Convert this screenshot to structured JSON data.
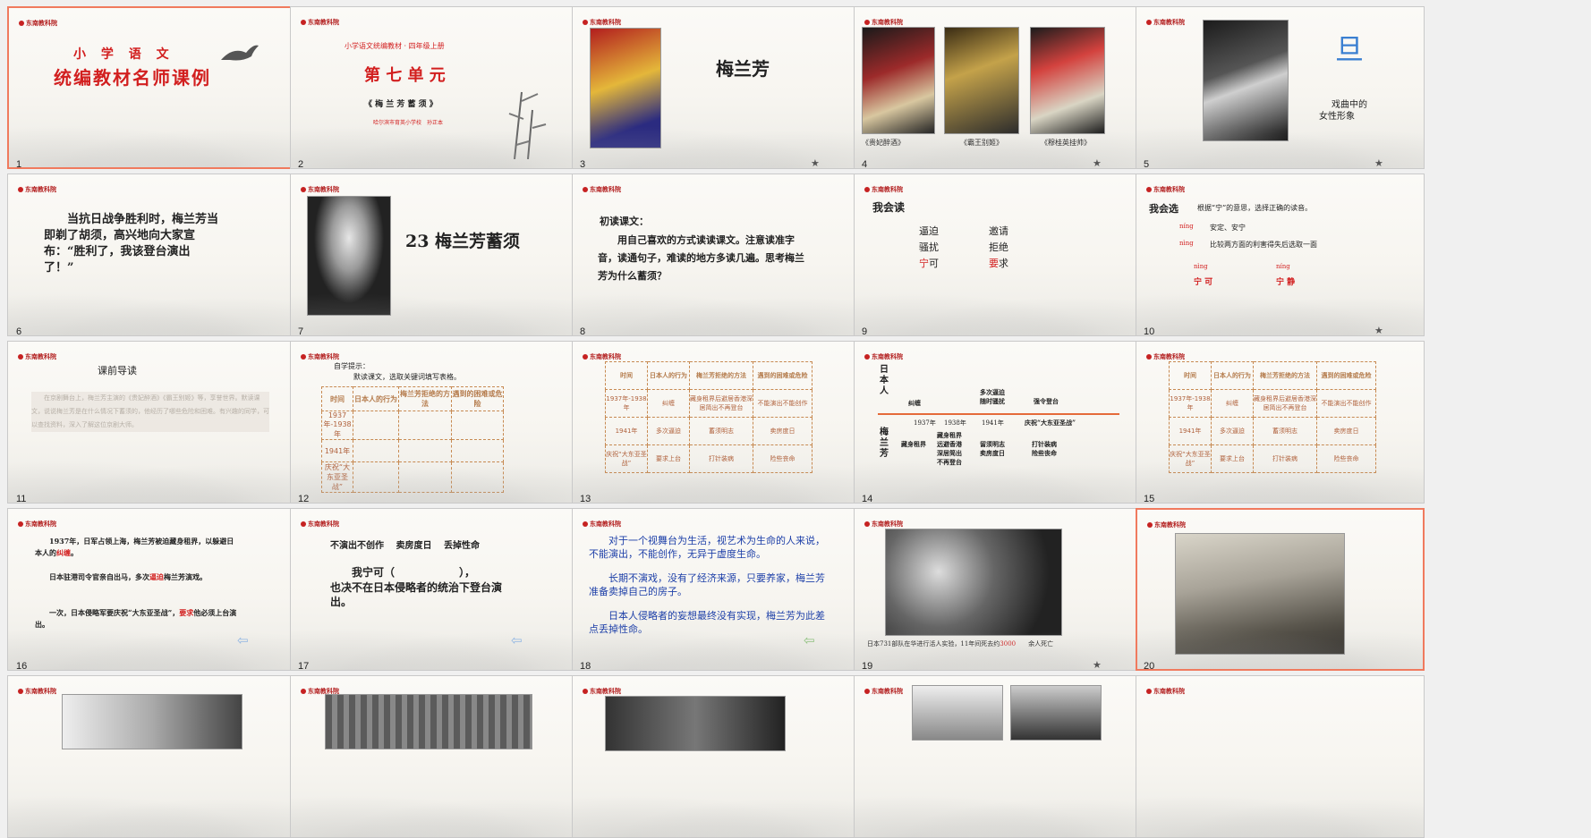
{
  "slides": {
    "s1": {
      "num": "1",
      "star": "",
      "logo": "东南教科院",
      "title1": "小 学 语 文",
      "title2": "统编教材名师课例"
    },
    "s2": {
      "num": "2",
      "star": "",
      "logo": "东南教科院",
      "line1": "小学语文统编教材 · 四年级上册",
      "unit": "第 七 单 元",
      "lesson": "《 梅 兰 芳 蓄 须 》",
      "author": "哈尔滨市育英小学校　孙正本"
    },
    "s3": {
      "num": "3",
      "star": "★",
      "logo": "东南教科院",
      "name": "梅兰芳"
    },
    "s4": {
      "num": "4",
      "star": "★",
      "logo": "东南教科院",
      "cap1": "《贵妃醉酒》",
      "cap2": "《霸王别姬》",
      "cap3": "《穆桂英挂帅》"
    },
    "s5": {
      "num": "5",
      "star": "★",
      "logo": "东南教科院",
      "char": "旦",
      "caption1": "戏曲中的",
      "caption2": "女性形象"
    },
    "s6": {
      "num": "6",
      "star": "",
      "logo": "东南教科院",
      "text": "　　当抗日战争胜利时，梅兰芳当即剃了胡须，高兴地向大家宣布：“胜利了，我该登台演出了！”"
    },
    "s7": {
      "num": "7",
      "star": "",
      "logo": "东南教科院",
      "title": "23 梅兰芳蓄须"
    },
    "s8": {
      "num": "8",
      "star": "",
      "logo": "东南教科院",
      "heading": "初读课文：",
      "text": "　　用自己喜欢的方式读读课文。注意读准字音，读通句子，难读的地方多读几遍。思考梅兰芳为什么蓄须？"
    },
    "s9": {
      "num": "9",
      "star": "",
      "logo": "东南教科院",
      "heading": "我会读",
      "w1": "逼迫",
      "w2": "邀请",
      "w3": "骚扰",
      "w4": "拒绝",
      "w5a": "宁",
      "w5b": "可",
      "w6a": "要",
      "w6b": "求"
    },
    "s10": {
      "num": "10",
      "star": "★",
      "logo": "东南教科院",
      "heading": "我会选",
      "prompt": "根据“宁”的意思，选择正确的读音。",
      "p1": "níng",
      "d1": "安定、安宁",
      "p2": "nìng",
      "d2": "比较两方面的利害得失后选取一面",
      "p3": "nìng",
      "w1": "宁 可",
      "p4": "níng",
      "w2": "宁 静"
    },
    "s11": {
      "num": "11",
      "star": "",
      "logo": "东南教科院",
      "heading": "课前导读",
      "text": "　　在京剧舞台上，梅兰芳主演的《贵妃醉酒》《霸王别姬》等，享誉世界。默读课文，说说梅兰芳是在什么情况下蓄须的，他经历了哪些危险和困难。有兴趣的同学，可以查找资料，深入了解这位京剧大师。"
    },
    "s12": {
      "num": "12",
      "star": "",
      "logo": "东南教科院",
      "tip1": "自学提示：",
      "tip2": "默读课文，选取关键词填写表格。",
      "h1": "时间",
      "h2": "日本人的行为",
      "h3": "梅兰芳拒绝的方法",
      "h4": "遇到的困难或危险",
      "r1": "1937年-1938年",
      "r2": "1941年",
      "r3": "庆祝“大东亚圣战”"
    },
    "s13": {
      "num": "13",
      "star": "",
      "logo": "东南教科院",
      "h1": "时间",
      "h2": "日本人的行为",
      "h3": "梅兰芳拒绝的方法",
      "h4": "遇到的困难或危险",
      "r1c1": "1937年-1938年",
      "r1c2": "纠缠",
      "r1c3": "藏身租界后避居香港深居简出不再登台",
      "r1c4": "不能演出不能创作",
      "r2c1": "1941年",
      "r2c2": "多次逼迫",
      "r2c3": "蓄须明志",
      "r2c4": "卖房度日",
      "r3c1": "庆祝“大东亚圣战”",
      "r3c2": "要求上台",
      "r3c3": "打针装病",
      "r3c4": "险些丧命"
    },
    "s14": {
      "num": "14",
      "star": "",
      "logo": "东南教科院",
      "side1": "日本人",
      "side2": "梅兰芳",
      "a1": "纠缠",
      "a2": "多次逼迫",
      "a2b": "随时骚扰",
      "a3": "强令登台",
      "y1": "1937年",
      "y2": "1938年",
      "y3": "1941年",
      "y4": "庆祝“大东亚圣战”",
      "b1": "藏身租界",
      "b2": "藏身租界 远避香港 深居简出 不再登台",
      "b3": "留须明志 卖房度日",
      "b4": "打针装病 险些丧命"
    },
    "s15": {
      "num": "15",
      "star": "",
      "logo": "东南教科院",
      "h1": "时间",
      "h2": "日本人的行为",
      "h3": "梅兰芳拒绝的方法",
      "h4": "遇到的困难或危险",
      "r1c1": "1937年-1938年",
      "r1c2": "纠缠",
      "r1c3": "藏身租界后避居香港深居简出不再登台",
      "r1c4": "不能演出不能创作",
      "r2c1": "1941年",
      "r2c2": "多次逼迫",
      "r2c3": "蓄须明志",
      "r2c4": "卖房度日",
      "r3c1": "庆祝“大东亚圣战”",
      "r3c2": "要求上台",
      "r3c3": "打针装病",
      "r3c4": "险些丧命"
    },
    "s16": {
      "num": "16",
      "star": "",
      "logo": "东南教科院",
      "p1a": "　　1937年，日军占领上海，梅兰芳被迫藏身租界，以躲避日本人的",
      "p1b": "纠缠",
      "p1c": "。",
      "p2a": "　　日本驻港司令官亲自出马，多次",
      "p2b": "逼迫",
      "p2c": "梅兰芳演戏。",
      "p3a": "　　一次，日本侵略军要庆祝“大东亚圣战”，",
      "p3b": "要求",
      "p3c": "他必须上台演出。"
    },
    "s17": {
      "num": "17",
      "star": "",
      "logo": "东南教科院",
      "line1": "不演出不创作　 卖房度日　 丢掉性命",
      "line2": "　　我宁可（　　　　　　），",
      "line3": "也决不在日本侵略者的统治下登台演出。"
    },
    "s18": {
      "num": "18",
      "star": "",
      "logo": "东南教科院",
      "p1": "　　对于一个视舞台为生活，视艺术为生命的人来说，不能演出，不能创作，无异于虚度生命。",
      "p2": "　　长期不演戏，没有了经济来源，只要养家，梅兰芳准备卖掉自己的房子。",
      "p3": "　　日本人侵略者的妄想最终没有实现，梅兰芳为此差点丢掉性命。"
    },
    "s19": {
      "num": "19",
      "star": "★",
      "logo": "东南教科院",
      "cap_a": "日本731部队在华进行活人实验，11年间死去约",
      "cap_b": "3000",
      "cap_c": "余人死亡"
    },
    "s20": {
      "num": "20",
      "star": "",
      "logo": "东南教科院"
    },
    "s21": {
      "logo": "东南教科院"
    },
    "s22": {
      "logo": "东南教科院"
    },
    "s23": {
      "logo": "东南教科院"
    },
    "s24": {
      "logo": "东南教科院"
    },
    "s25": {
      "logo": "东南教科院"
    }
  }
}
